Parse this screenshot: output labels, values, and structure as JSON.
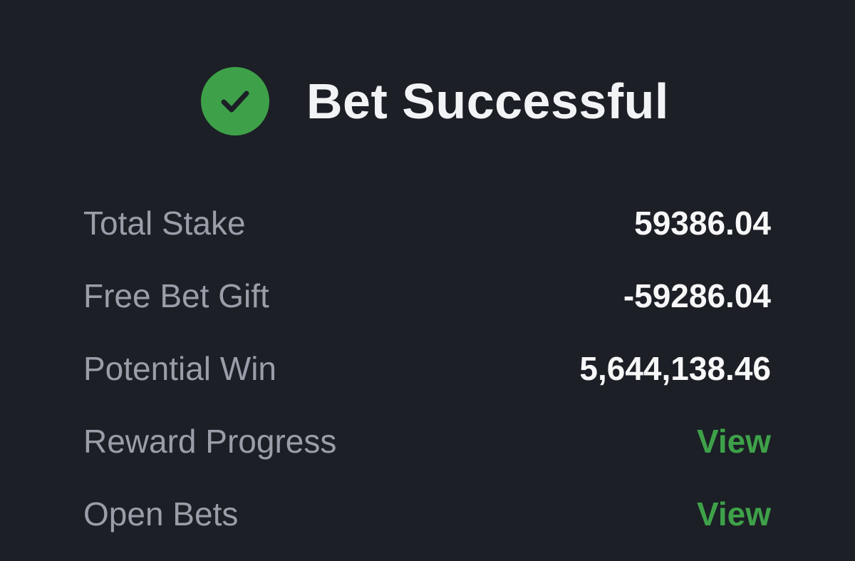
{
  "header": {
    "title": "Bet Successful",
    "icon": "check-circle-icon"
  },
  "summary": {
    "rows": [
      {
        "label": "Total Stake",
        "value": "59386.04"
      },
      {
        "label": "Free Bet Gift",
        "value": "-59286.04"
      },
      {
        "label": "Potential Win",
        "value": "5,644,138.46"
      }
    ],
    "actions": [
      {
        "label": "Reward Progress",
        "link": "View"
      },
      {
        "label": "Open Bets",
        "link": "View"
      }
    ]
  },
  "colors": {
    "background": "#1c1f26",
    "success": "#3ea149",
    "text": "#f2f3f5",
    "muted": "#9a9ea8"
  }
}
